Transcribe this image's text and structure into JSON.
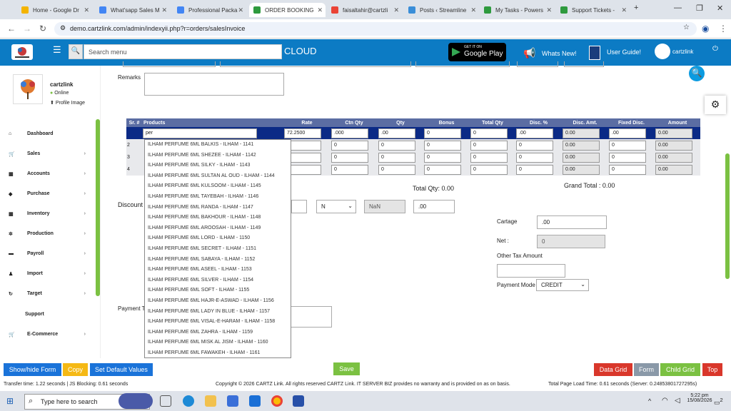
{
  "browser": {
    "tabs": [
      "Home - Google Dr",
      "What'sapp Sales M",
      "Professional Packa",
      "ORDER BOOKING",
      "faisaltahir@cartzli",
      "Posts ‹ Streamline",
      "My Tasks - Powers",
      "Support Tickets - "
    ],
    "url": "demo.cartzlink.com/admin/indexyii.php?r=orders/salesInvoice"
  },
  "header": {
    "search_placeholder": "Search menu",
    "cloud": "CLOUD",
    "gplay_small": "GET IT ON",
    "gplay_big": "Google Play",
    "whats_new": "Whats New!",
    "user_guide": "User Guide!",
    "user": "cartzlink"
  },
  "sidebar": {
    "user": "cartzlink",
    "status": "Online",
    "profile": "Profile Image",
    "items": [
      {
        "label": "Dashboard",
        "icon": "home-icon"
      },
      {
        "label": "Sales",
        "icon": "cart-icon"
      },
      {
        "label": "Accounts",
        "icon": "bank-icon"
      },
      {
        "label": "Purchase",
        "icon": "tag-icon"
      },
      {
        "label": "Inventory",
        "icon": "grid-icon"
      },
      {
        "label": "Production",
        "icon": "cog-icon"
      },
      {
        "label": "Payroll",
        "icon": "money-icon"
      },
      {
        "label": "Import",
        "icon": "user-icon"
      },
      {
        "label": "Target",
        "icon": "refresh-icon"
      },
      {
        "label": "Support",
        "icon": ""
      },
      {
        "label": "E-Commerce",
        "icon": "cart-icon"
      }
    ]
  },
  "form": {
    "remarks_label": "Remarks",
    "discount_label": "Discount",
    "payment_terms_label": "Payment Te",
    "total_qty": "Total Qty: 0.00",
    "grand_total": "Grand Total :  0.00",
    "n_select": "N",
    "nan": "NaN",
    "disc_val": ".00",
    "cartage_label": "Cartage",
    "cartage": ".00",
    "net_label": "Net :",
    "net": "0",
    "other_tax_label": "Other Tax Amount",
    "payment_mode_label": "Payment Mode",
    "payment_mode": "CREDIT"
  },
  "grid": {
    "headers": [
      "Sr. #",
      "Products",
      "Rate",
      "Ctn Qty",
      "Qty",
      "Bonus",
      "Total Qty",
      "Disc. %",
      "Disc. Amt.",
      "Fixed Disc.",
      "Amount"
    ],
    "row1": {
      "product": "per",
      "rate": "72.2500",
      "ctn": ".000",
      ".qty": ".00",
      "qty": ".00",
      "bonus": "0",
      "total": "0",
      "disc": ".00",
      "discamt": "0.00",
      "fixed": ".00",
      "amount": "0.00"
    },
    "rows": [
      "2",
      "3",
      "4"
    ],
    "zero": "0",
    "zero2": "0.00"
  },
  "dropdown": [
    "ILHAM PERFUME 6ML BALKIS - ILHAM - 1141",
    "ILHAM PERFUME 6ML SHEZEE - ILHAM - 1142",
    "ILHAM PERFUME 6ML SILKY - ILHAM - 1143",
    "ILHAM PERFUME 6ML SULTAN AL OUD - ILHAM - 1144",
    "ILHAM PERFUME 6ML KULSOOM - ILHAM - 1145",
    "ILHAM PERFUME 6ML TAYEBAH - ILHAM - 1146",
    "ILHAM PERFUME 6ML RANDA - ILHAM - 1147",
    "ILHAM PERFUME 6ML BAKHOUR - ILHAM - 1148",
    "ILHAM PERFUME 6ML AROOSAH - ILHAM - 1149",
    "ILHAM PERFUME 6ML LORD - ILHAM - 1150",
    "ILHAM PERFUME 6ML SECRET - ILHAM - 1151",
    "ILHAM PERFUME 6ML SABAYA - ILHAM - 1152",
    "ILHAM PERFUME 6ML ASEEL - ILHAM - 1153",
    "ILHAM PERFUME 6ML SILVER - ILHAM - 1154",
    "ILHAM PERFUME 6ML SOFT - ILHAM - 1155",
    "ILHAM PERFUME 6ML HAJR-E-ASWAD - ILHAM - 1156",
    "ILHAM PERFUME 6ML LADY IN BLUE - ILHAM - 1157",
    "ILHAM PERFUME 6ML VISAL-E-HARAM - ILHAM - 1158",
    "ILHAM PERFUME 6ML ZAHRA - ILHAM - 1159",
    "ILHAM PERFUME 6ML MISK AL JISM - ILHAM - 1160",
    "ILHAM PERFUME 6ML FAWAKEH - ILHAM - 1161"
  ],
  "buttons": {
    "showhide": "Show/hide Form",
    "copy": "Copy",
    "setdefault": "Set Default Values",
    "save": "Save",
    "datagrid": "Data Grid",
    "form": "Form",
    "childgrid": "Child Grid",
    "top": "Top"
  },
  "status": {
    "left": "Transfer time: 1.22 seconds  | JS Blocking: 0.61 seconds",
    "center": "Copyright © 2026 CARTZ Link. All rights reserved CARTZ Link. IT SERVER BIZ provides no warranty and is provided on as on basis.",
    "right": "Total Page Load Time: 0.61 seconds (Server: 0.24853801727295s)"
  },
  "taskbar": {
    "search": "Type here to search",
    "time": "5:22 pm",
    "date": "15/08/2026",
    "notif": "2"
  },
  "colors": {
    "header": "#0c7bc4",
    "grid_header": "#5b6da3",
    "selected_row": "#0b2a86",
    "green": "#7bc142"
  }
}
